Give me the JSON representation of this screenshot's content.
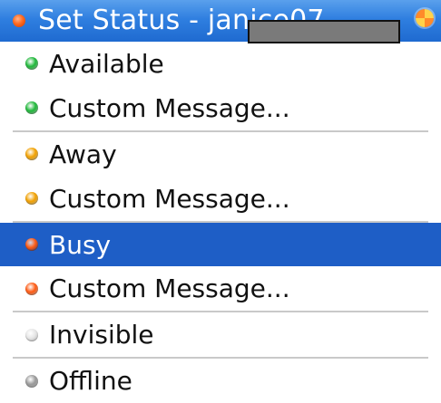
{
  "window": {
    "title": "Set Status - janice07"
  },
  "menu": {
    "items": [
      {
        "label": "Available",
        "status_color": "#1fb83a"
      },
      {
        "label": "Custom Message...",
        "status_color": "#1fb83a"
      },
      {
        "label": "Away",
        "status_color": "#f2a100"
      },
      {
        "label": "Custom Message...",
        "status_color": "#f2a100"
      },
      {
        "label": "Busy",
        "status_color": "#ff5a12",
        "selected": true
      },
      {
        "label": "Custom Message...",
        "status_color": "#ff5a12"
      },
      {
        "label": "Invisible",
        "status_color": "#e6e6e6"
      },
      {
        "label": "Offline",
        "status_color": "#9a9a9a"
      }
    ]
  },
  "theme": {
    "title_bar": "#2f7fe0",
    "selection": "#1e5ec6",
    "separator": "#c9c9c9"
  },
  "icons": {
    "title_status": "status-dot-busy-icon",
    "app": "app-logo-icon"
  }
}
